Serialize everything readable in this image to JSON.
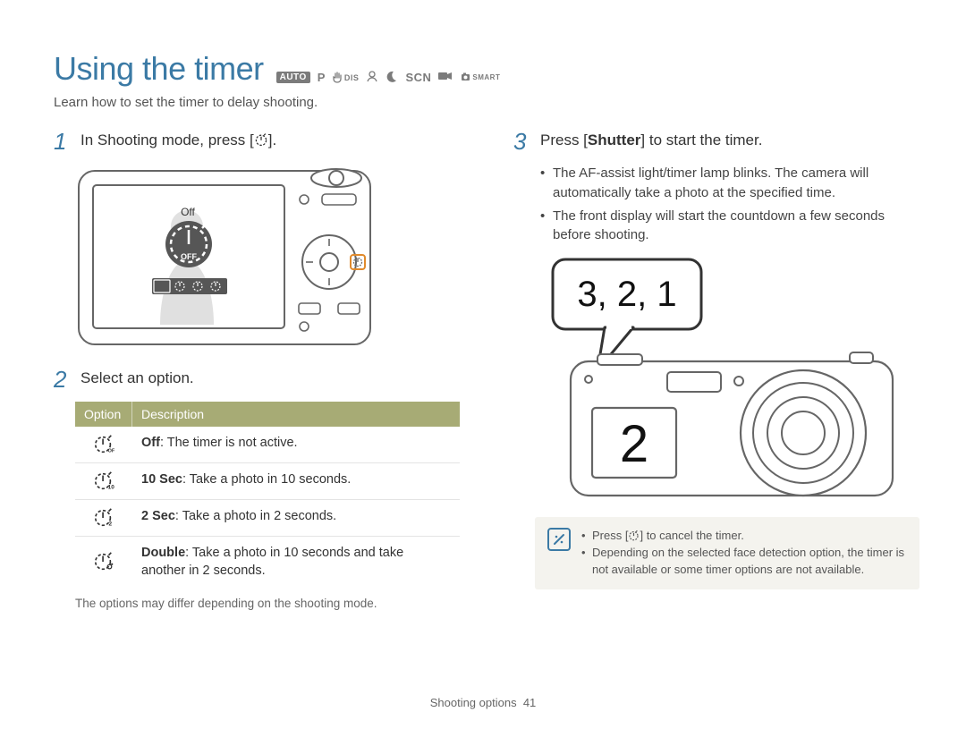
{
  "title": "Using the timer",
  "mode_icons": {
    "auto": "AUTO",
    "p": "P",
    "dis": "DIS",
    "scn": "SCN",
    "smart": "SMART"
  },
  "subtitle": "Learn how to set the timer to delay shooting.",
  "left": {
    "step1_num": "1",
    "step1_text_a": "In Shooting mode, press [",
    "step1_text_b": "].",
    "off_label": "Off",
    "off_badge": "OFF",
    "step2_num": "2",
    "step2_text": "Select an option.",
    "table": {
      "head_option": "Option",
      "head_desc": "Description",
      "rows": [
        {
          "icon": "off",
          "bold": "Off",
          "rest": ": The timer is not active."
        },
        {
          "icon": "10",
          "bold": "10 Sec",
          "rest": ": Take a photo in 10 seconds."
        },
        {
          "icon": "2",
          "bold": "2 Sec",
          "rest": ": Take a photo in 2 seconds."
        },
        {
          "icon": "double",
          "bold": "Double",
          "rest": ": Take a photo in 10 seconds and take another in 2 seconds."
        }
      ]
    },
    "note": "The options may differ depending on the shooting mode."
  },
  "right": {
    "step3_num": "3",
    "step3_text_a": "Press [",
    "step3_text_bold": "Shutter",
    "step3_text_b": "] to start the timer.",
    "bullets": [
      "The AF-assist light/timer lamp blinks. The camera will automatically take a photo at the specified time.",
      "The front display will start the countdown a few seconds before shooting."
    ],
    "bubble": "3, 2, 1",
    "front_display": "2",
    "note_box": [
      {
        "pre": "Press [",
        "post": "] to cancel the timer."
      },
      {
        "text": "Depending on the selected face detection option, the timer is not available or some timer options are not available."
      }
    ]
  },
  "footer": {
    "label": "Shooting options",
    "page": "41"
  }
}
